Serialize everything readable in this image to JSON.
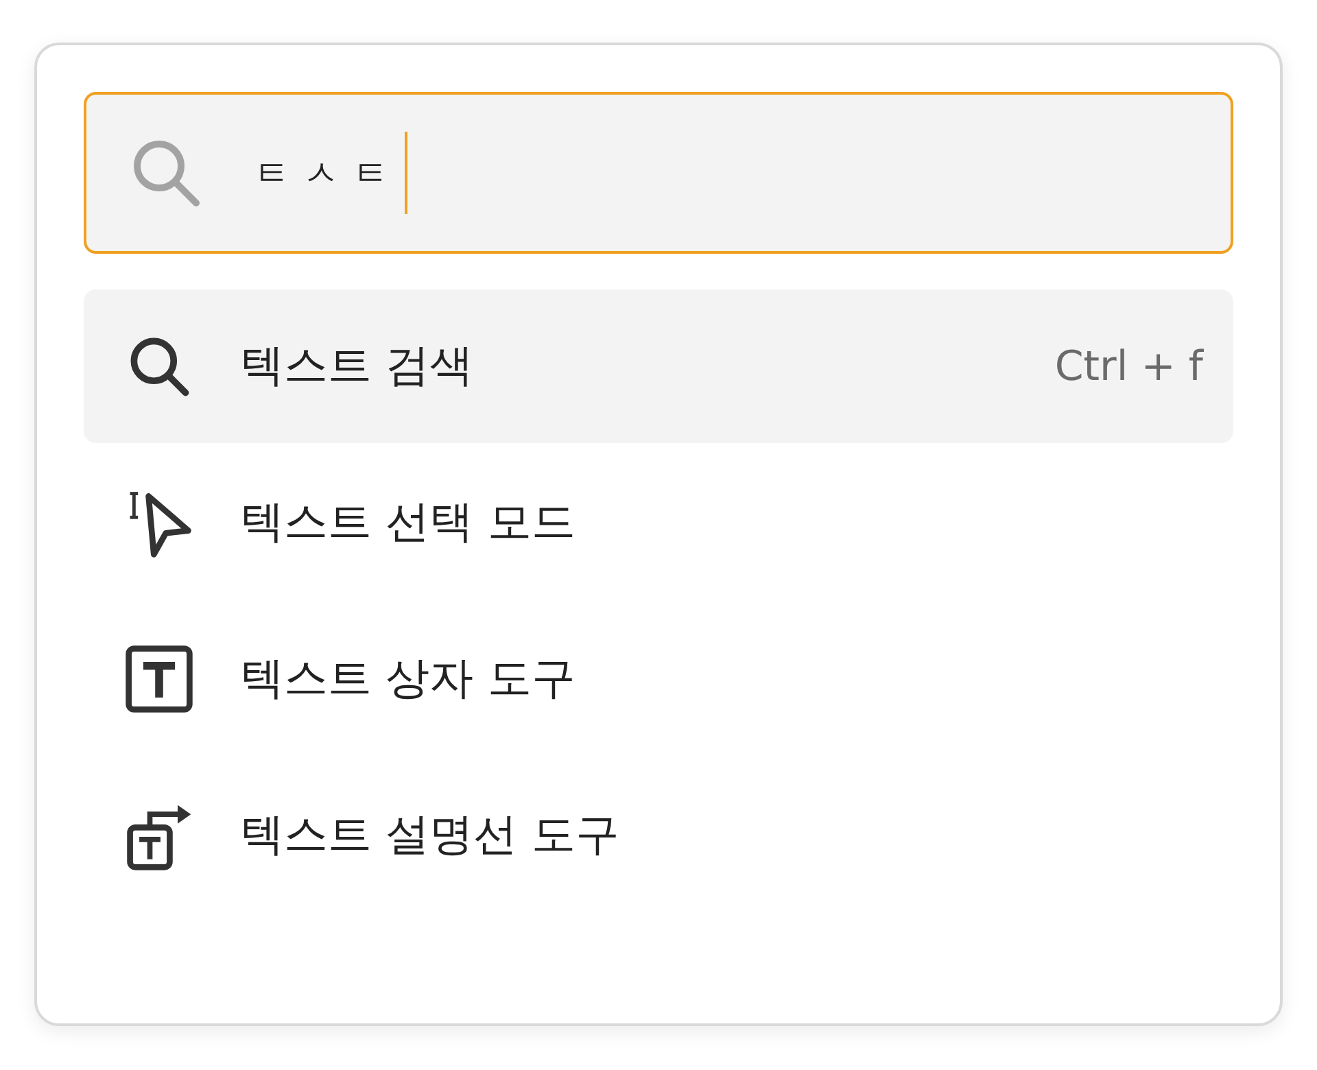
{
  "search": {
    "value": "ㅌㅅㅌ",
    "focused": true
  },
  "results": [
    {
      "kind": "search",
      "label": "텍스트 검색",
      "shortcut": "Ctrl + f",
      "selected": true
    },
    {
      "kind": "select",
      "label": "텍스트 선택 모드",
      "selected": false
    },
    {
      "kind": "textbox",
      "label": "텍스트 상자 도구",
      "selected": false
    },
    {
      "kind": "callout",
      "label": "텍스트 설명선 도구",
      "selected": false
    }
  ]
}
